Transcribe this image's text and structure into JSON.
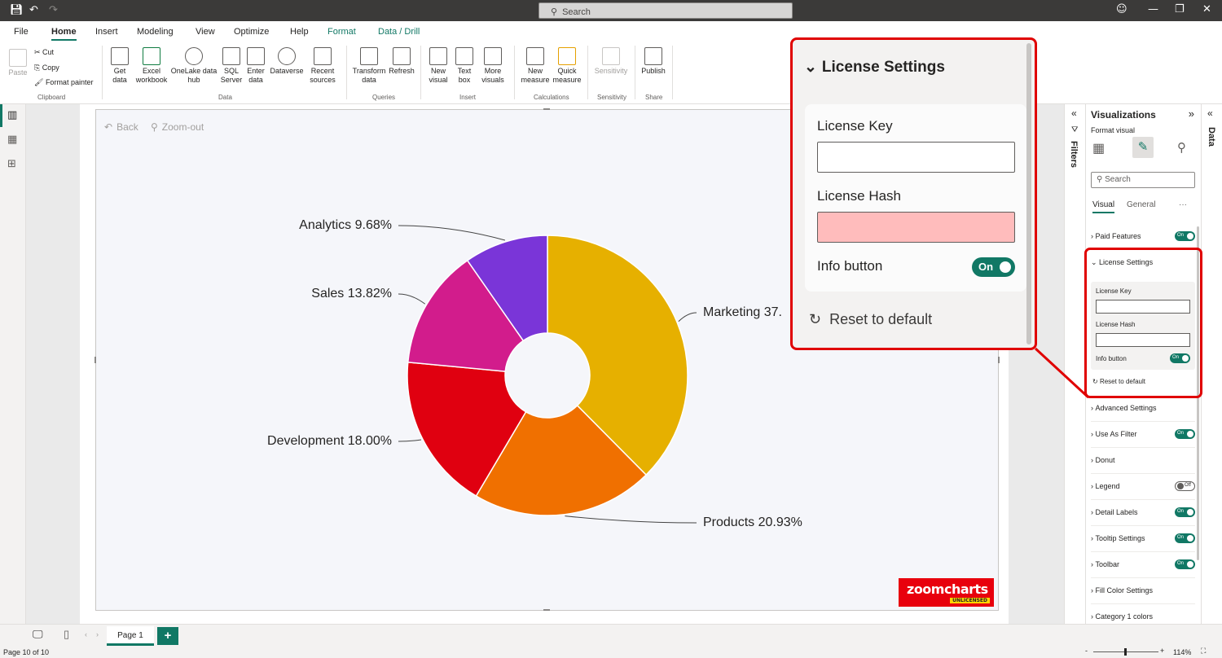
{
  "titlebar": {
    "search_placeholder": "Search"
  },
  "tabs": [
    "File",
    "Home",
    "Insert",
    "Modeling",
    "View",
    "Optimize",
    "Help",
    "Format",
    "Data / Drill"
  ],
  "ribbon": {
    "clipboard": {
      "paste": "Paste",
      "cut": "Cut",
      "copy": "Copy",
      "format_painter": "Format painter",
      "group": "Clipboard"
    },
    "data": {
      "get_data": "Get data",
      "excel": "Excel workbook",
      "onelake": "OneLake data hub",
      "sql": "SQL Server",
      "enter": "Enter data",
      "dataverse": "Dataverse",
      "recent": "Recent sources",
      "group": "Data"
    },
    "queries": {
      "transform": "Transform data",
      "refresh": "Refresh",
      "group": "Queries"
    },
    "insert": {
      "new_visual": "New visual",
      "text_box": "Text box",
      "more_visuals": "More visuals",
      "group": "Insert"
    },
    "calculations": {
      "new_measure": "New measure",
      "quick_measure": "Quick measure",
      "group": "Calculations"
    },
    "sensitivity": {
      "label": "Sensitivity",
      "group": "Sensitivity"
    },
    "share": {
      "publish": "Publish",
      "group": "Share"
    }
  },
  "visual": {
    "back": "Back",
    "zoom_out": "Zoom-out",
    "logo_text": "zoomcharts",
    "logo_badge": "UNLICENSED"
  },
  "chart_data": {
    "type": "pie",
    "donut": true,
    "categories": [
      "Marketing",
      "Products",
      "Development",
      "Sales",
      "Analytics"
    ],
    "values": [
      37.57,
      20.93,
      18.0,
      13.82,
      9.68
    ],
    "labels": [
      "Marketing 37.",
      "Products 20.93%",
      "Development 18.00%",
      "Sales 13.82%",
      "Analytics 9.68%"
    ],
    "colors": [
      "#e6b000",
      "#f07000",
      "#e00010",
      "#d21c8c",
      "#7a35d8"
    ]
  },
  "filters_label": "Filters",
  "viz_pane": {
    "title": "Visualizations",
    "subtitle": "Format visual",
    "search_placeholder": "Search",
    "tab_visual": "Visual",
    "tab_general": "General",
    "more": "···",
    "sections": [
      {
        "label": "Paid Features",
        "toggle": "On"
      },
      {
        "label": "License Settings"
      },
      {
        "label": "Advanced Settings"
      },
      {
        "label": "Use As Filter",
        "toggle": "On"
      },
      {
        "label": "Donut"
      },
      {
        "label": "Legend",
        "toggle": "Off"
      },
      {
        "label": "Detail Labels",
        "toggle": "On"
      },
      {
        "label": "Tooltip Settings",
        "toggle": "On"
      },
      {
        "label": "Toolbar",
        "toggle": "On"
      },
      {
        "label": "Fill Color Settings"
      },
      {
        "label": "Category 1 colors"
      }
    ],
    "license": {
      "key_label": "License Key",
      "hash_label": "License Hash",
      "info_label": "Info button",
      "info_toggle": "On",
      "reset": "Reset to default"
    }
  },
  "zoom_panel": {
    "title": "License Settings",
    "key_label": "License Key",
    "hash_label": "License Hash",
    "info_label": "Info button",
    "info_toggle": "On",
    "reset": "Reset to default",
    "hash_field_color": "#ffbcbc"
  },
  "data_label": "Data",
  "pages": {
    "current": "Page 1",
    "add": "+"
  },
  "status": {
    "page_info": "Page 10 of 10",
    "zoom": "114%"
  }
}
